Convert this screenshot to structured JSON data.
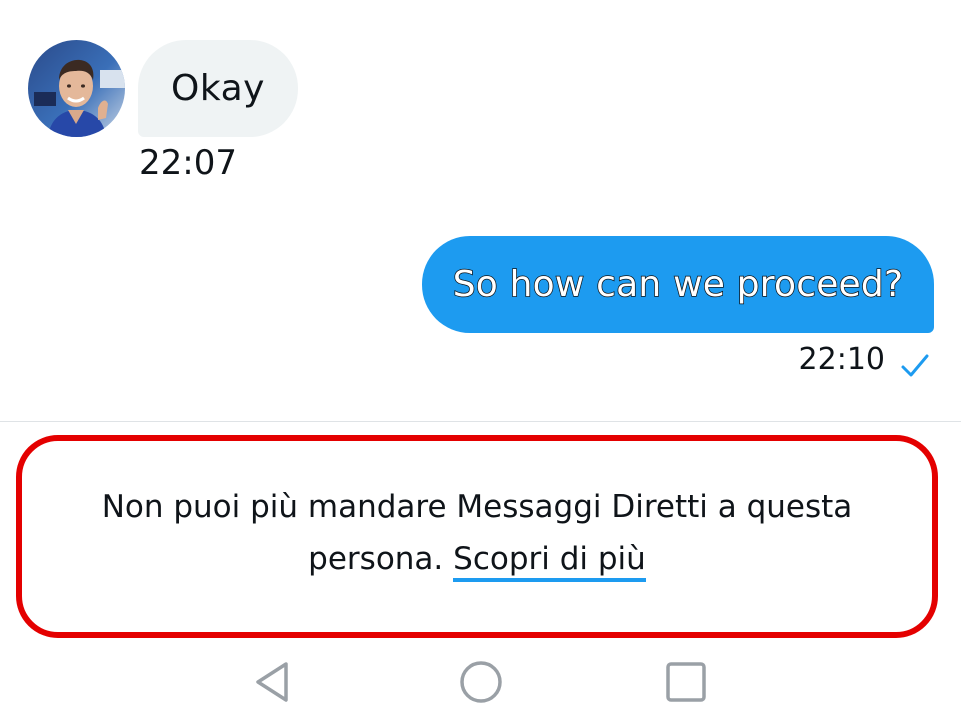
{
  "conversation": {
    "messages": [
      {
        "direction": "incoming",
        "text": "Okay",
        "time": "22:07",
        "sender_avatar": "avatar-photo"
      },
      {
        "direction": "outgoing",
        "text": "So how can we proceed?",
        "time": "22:10",
        "status_icon": "check-icon"
      }
    ]
  },
  "notice": {
    "text": "Non puoi più mandare Messaggi Diretti a questa persona.",
    "link_label": "Scopri di più",
    "border_color": "#e40000"
  },
  "nav_bar": {
    "buttons": [
      "back-icon",
      "home-icon",
      "recents-icon"
    ]
  },
  "colors": {
    "accent": "#1d9bf0",
    "incoming_bubble": "#eff3f4",
    "text": "#0f1419"
  }
}
